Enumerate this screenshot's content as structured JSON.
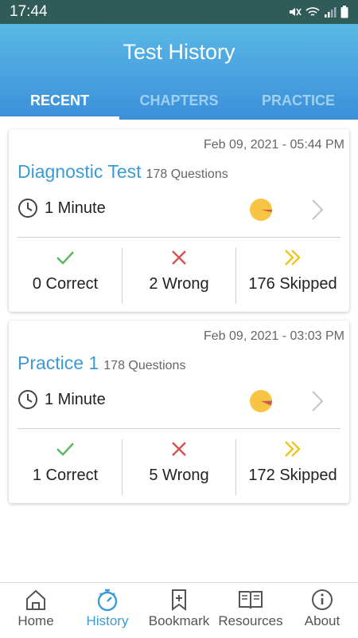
{
  "status_bar": {
    "time": "17:44"
  },
  "header": {
    "title": "Test History",
    "tabs": [
      {
        "label": "RECENT",
        "active": true
      },
      {
        "label": "CHAPTERS",
        "active": false
      },
      {
        "label": "PRACTICE",
        "active": false
      }
    ]
  },
  "tests": [
    {
      "date": "Feb 09, 2021 - 05:44 PM",
      "title": "Diagnostic Test",
      "questions": "178 Questions",
      "duration": "1 Minute",
      "correct_label": "0 Correct",
      "wrong_label": "2 Wrong",
      "skipped_label": "176 Skipped"
    },
    {
      "date": "Feb 09, 2021 - 03:03 PM",
      "title": "Practice 1",
      "questions": "178 Questions",
      "duration": "1 Minute",
      "correct_label": "1 Correct",
      "wrong_label": "5 Wrong",
      "skipped_label": "172 Skipped"
    }
  ],
  "bottom_nav": [
    {
      "label": "Home",
      "icon": "home-icon"
    },
    {
      "label": "History",
      "icon": "stopwatch-icon",
      "active": true
    },
    {
      "label": "Bookmark",
      "icon": "bookmark-icon"
    },
    {
      "label": "Resources",
      "icon": "book-icon"
    },
    {
      "label": "About",
      "icon": "info-icon"
    }
  ],
  "colors": {
    "accent": "#3b9bd4",
    "header_top": "#5bb8e6",
    "header_bottom": "#3b8fd9",
    "correct": "#5cb85c",
    "wrong": "#d9534f",
    "skipped": "#f0c420",
    "progress": "#f7c444"
  }
}
